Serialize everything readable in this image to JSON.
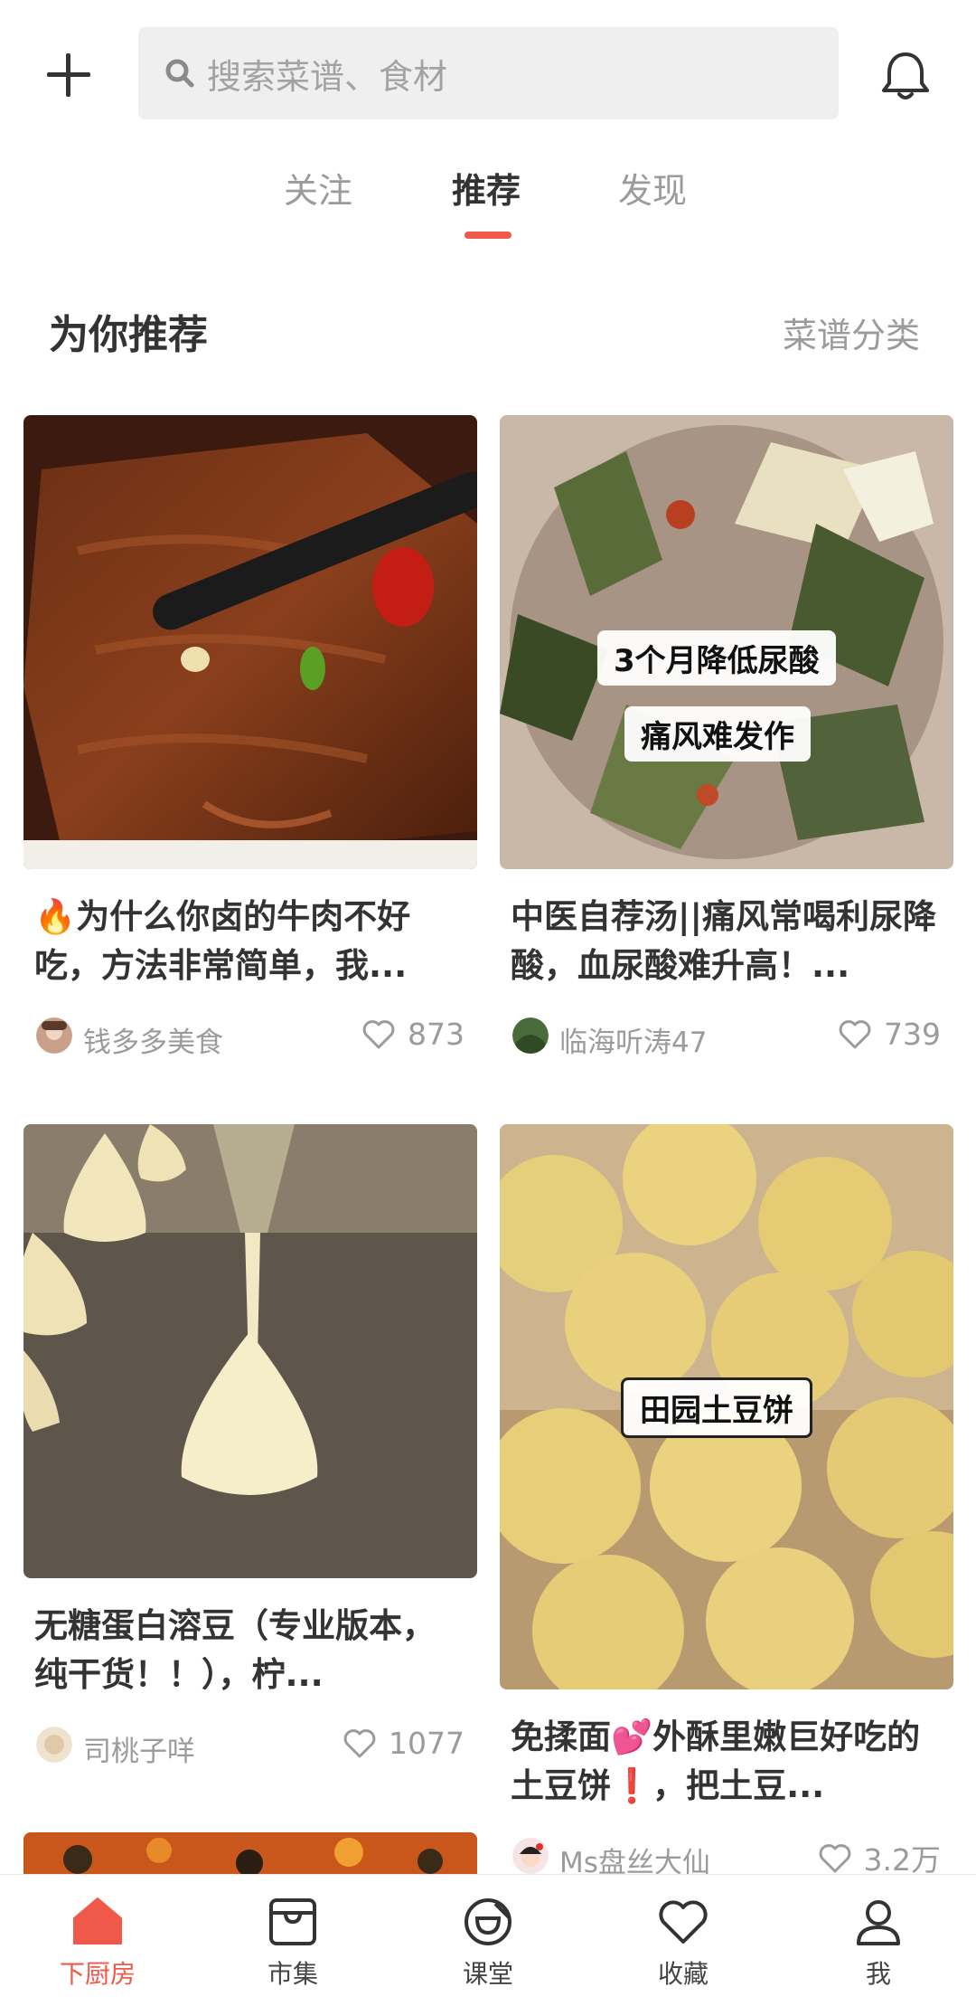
{
  "header": {
    "search_placeholder": "搜索菜谱、食材"
  },
  "tabs": [
    {
      "label": "关注",
      "active": false
    },
    {
      "label": "推荐",
      "active": true
    },
    {
      "label": "发现",
      "active": false
    }
  ],
  "section": {
    "title": "为你推荐",
    "link": "菜谱分类"
  },
  "cards": [
    {
      "title": "🔥为什么你卤的牛肉不好吃，方法非常简单，我...",
      "author": "钱多多美食",
      "likes": "873",
      "image": "braised-beef-photo"
    },
    {
      "title": "中医自荐汤||痛风常喝利尿降酸，血尿酸难升高！...",
      "author": "临海听涛47",
      "likes": "739",
      "image": "herbal-soup-photo",
      "overlay": [
        "3个月降低尿酸",
        "痛风难发作"
      ]
    },
    {
      "title": "无糖蛋白溶豆（专业版本，纯干货！！），柠...",
      "author": "司桃子咩",
      "likes": "1077",
      "image": "meringue-drops-photo"
    },
    {
      "title": "免揉面💕外酥里嫩巨好吃的土豆饼❗，把土豆...",
      "author": "Ms盘丝大仙",
      "likes": "3.2万",
      "image": "potato-pancakes-photo",
      "overlay": [
        "田园土豆饼"
      ]
    }
  ],
  "bottom_nav": [
    {
      "label": "下厨房",
      "icon": "home-icon",
      "active": true
    },
    {
      "label": "市集",
      "icon": "market-icon",
      "active": false
    },
    {
      "label": "课堂",
      "icon": "classroom-icon",
      "active": false
    },
    {
      "label": "收藏",
      "icon": "heart-icon",
      "active": false
    },
    {
      "label": "我",
      "icon": "profile-icon",
      "active": false
    }
  ],
  "colors": {
    "accent": "#f0594a",
    "text_primary": "#333333",
    "text_secondary": "#9b9b9b",
    "search_bg": "#efefef"
  }
}
